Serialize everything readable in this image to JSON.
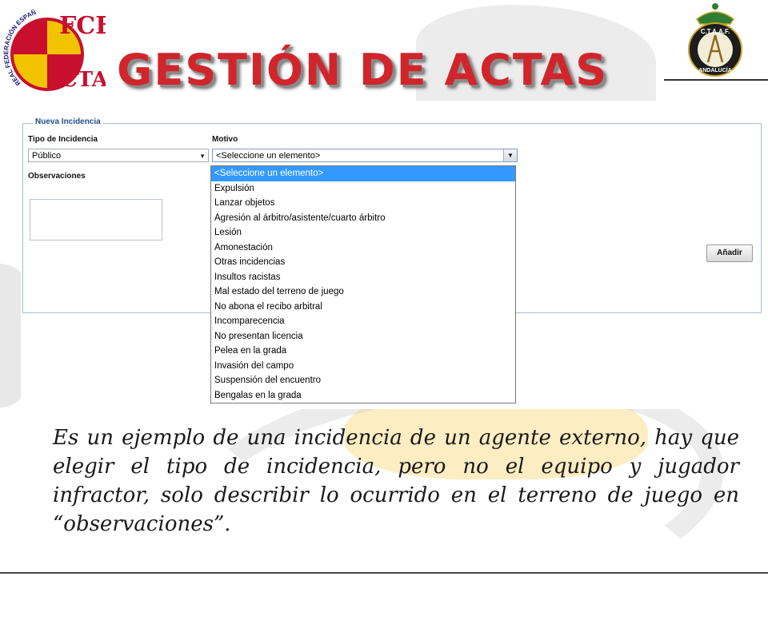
{
  "header": {
    "title": "GESTIÓN DE ACTAS",
    "logo_left": {
      "initials_top": "FCF",
      "initials_bottom": "CTA",
      "ring_text": "REAL FEDERACIÓN ESPAÑOLA DE FÚTBOL"
    },
    "logo_right": {
      "initials": "C.T.A.A.F.",
      "ring_text": "ANDALUCÍA"
    }
  },
  "form": {
    "legend": "Nueva Incidencia",
    "tipo_label": "Tipo de Incidencia",
    "tipo_value": "Público",
    "motivo_label": "Motivo",
    "motivo_value": "<Seleccione un elemento>",
    "observaciones_label": "Observaciones",
    "add_button": "Añadir",
    "motivo_options": [
      "<Seleccione un elemento>",
      "Expulsión",
      "Lanzar objetos",
      "Agresión al árbitro/asistente/cuarto árbitro",
      "Lesión",
      "Amonestación",
      "Otras incidencias",
      "Insultos racistas",
      "Mal estado del terreno de juego",
      "No abona el recibo arbitral",
      "Incomparecencia",
      "No presentan licencia",
      "Pelea en la grada",
      "Invasión del campo",
      "Suspensión del encuentro",
      "Bengalas en la grada"
    ],
    "selected_index": 0
  },
  "caption": "Es un ejemplo de una incidencia de un agente externo, hay que elegir el tipo de incidencia, pero no el equipo y jugador infractor, solo describir lo ocurrido en el terreno de juego en “observaciones”.",
  "colors": {
    "title": "#d0252a",
    "legend": "#1f4f8b",
    "selection": "#3399ff"
  }
}
